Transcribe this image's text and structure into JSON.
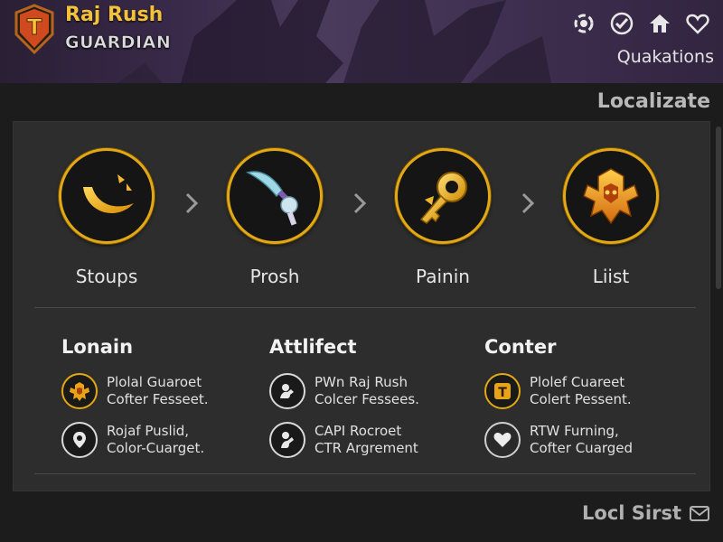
{
  "header": {
    "brand_title": "Raj Rush",
    "brand_subtitle": "GUARDIAN",
    "icons": [
      "refresh-icon",
      "check-icon",
      "home-icon",
      "heart-icon"
    ],
    "link_label": "Quakations"
  },
  "section": {
    "title": "Localizate"
  },
  "steps": [
    {
      "label": "Stoups",
      "icon": "crescent-moon-icon"
    },
    {
      "label": "Prosh",
      "icon": "sword-icon"
    },
    {
      "label": "Painin",
      "icon": "golden-key-icon"
    },
    {
      "label": "Liist",
      "icon": "armor-crest-icon"
    }
  ],
  "columns": [
    {
      "title": "Lonain",
      "items": [
        {
          "line1": "Plolal Guaroet",
          "line2": "Cofter Fesseet.",
          "icon": "armor-crest-icon"
        },
        {
          "line1": "Rojaf Puslid,",
          "line2": "Color-Cuarget.",
          "icon": "location-pin-icon"
        }
      ]
    },
    {
      "title": "Attlifect",
      "items": [
        {
          "line1": "PWn Raj Rush",
          "line2": "Colcer Fessees.",
          "icon": "character-icon"
        },
        {
          "line1": "CAPI Rocroet",
          "line2": "CTR Argrement",
          "icon": "character-icon"
        }
      ]
    },
    {
      "title": "Conter",
      "items": [
        {
          "line1": "Plolef Cuareet",
          "line2": "Colert Pessent.",
          "icon": "tr-logo-icon"
        },
        {
          "line1": "RTW Furning,",
          "line2": "Cofter Cuarged",
          "icon": "heart-icon"
        }
      ]
    }
  ],
  "footer": {
    "link_label": "Locl Sirst",
    "icon": "mail-icon"
  },
  "colors": {
    "accent": "#e2a816",
    "brand": "#f2c23a",
    "header_bg": "#3a2a4a",
    "card_bg": "#2d2d2d"
  }
}
